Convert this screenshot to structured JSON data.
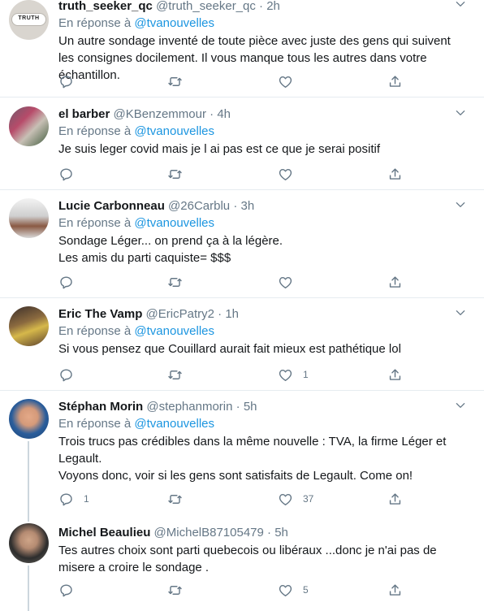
{
  "tweets": [
    {
      "name": "truth_seeker_qc",
      "handle": "@truth_seeker_qc",
      "dot": "·",
      "time": "2h",
      "reply_prefix": "En réponse à",
      "reply_to": "@tvanouvelles",
      "lines": [
        "Un autre sondage inventé de toute pièce avec juste des gens qui suivent les consignes docilement.  Il vous manque tous les autres dans votre échantillon."
      ],
      "avatar_text": "TRUTH",
      "replies": "",
      "retweets": "",
      "likes": ""
    },
    {
      "name": "el barber",
      "handle": "@KBenzemmour",
      "dot": "·",
      "time": "4h",
      "reply_prefix": "En réponse à",
      "reply_to": "@tvanouvelles",
      "lines": [
        "Je suis leger covid mais je l ai pas est ce que je serai positif"
      ],
      "replies": "",
      "retweets": "",
      "likes": ""
    },
    {
      "name": "Lucie Carbonneau",
      "handle": "@26Carblu",
      "dot": "·",
      "time": "3h",
      "reply_prefix": "En réponse à",
      "reply_to": "@tvanouvelles",
      "lines": [
        "Sondage Léger... on prend ça à la légère.",
        "Les amis du parti caquiste= $$$"
      ],
      "replies": "",
      "retweets": "",
      "likes": ""
    },
    {
      "name": "Eric The Vamp",
      "handle": "@EricPatry2",
      "dot": "·",
      "time": "1h",
      "reply_prefix": "En réponse à",
      "reply_to": "@tvanouvelles",
      "lines": [
        "Si vous pensez que Couillard aurait fait mieux est pathétique lol"
      ],
      "replies": "",
      "retweets": "",
      "likes": "1"
    },
    {
      "name": "Stéphan Morin",
      "handle": "@stephanmorin",
      "dot": "·",
      "time": "5h",
      "reply_prefix": "En réponse à",
      "reply_to": "@tvanouvelles",
      "lines": [
        "Trois trucs pas crédibles dans la même nouvelle : TVA, la firme Léger et Legault.",
        "Voyons donc, voir si les gens sont satisfaits de Legault. Come on!"
      ],
      "replies": "1",
      "retweets": "",
      "likes": "37"
    },
    {
      "name": "Michel Beaulieu",
      "handle": "@MichelB87105479",
      "dot": "·",
      "time": "5h",
      "lines": [
        "Tes autres choix sont parti quebecois ou libéraux ...donc je n'ai pas de misere a croire le sondage ."
      ],
      "replies": "",
      "retweets": "",
      "likes": "5"
    }
  ],
  "colors": {
    "link": "#1b95e0",
    "secondary_text": "#657786",
    "separator": "#e6ecf0",
    "thread_line": "#ccd6dd"
  },
  "icons": [
    "reply-icon",
    "retweet-icon",
    "like-icon",
    "share-icon",
    "caret-down-icon"
  ]
}
